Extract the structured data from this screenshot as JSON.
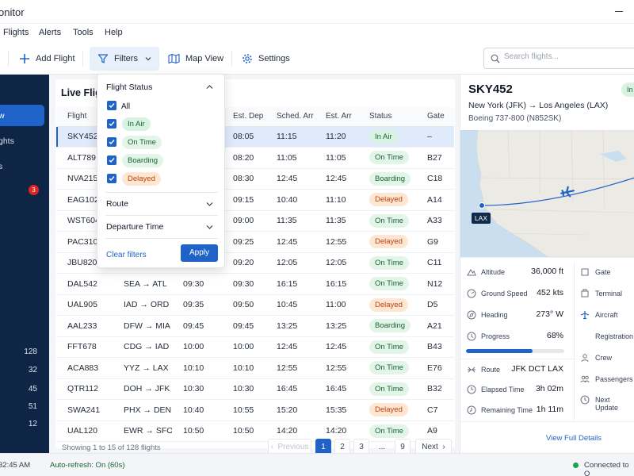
{
  "window": {
    "title": "onitor"
  },
  "menu": [
    "Flights",
    "Alerts",
    "Tools",
    "Help"
  ],
  "toolbar": {
    "add_flight": "Add Flight",
    "filters": "Filters",
    "map_view": "Map View",
    "settings": "Settings",
    "search_placeholder": "Search flights..."
  },
  "sidebar": {
    "items": [
      "w",
      "ghts",
      "s"
    ],
    "badge": "3",
    "counts": [
      "128",
      "32",
      "45",
      "51",
      "12"
    ]
  },
  "list": {
    "title": "Live Fligh",
    "columns": [
      "Flight",
      "Route",
      "Sched. Dep",
      "Est. Dep",
      "Sched. Arr",
      "Est. Arr",
      "Status",
      "Gate"
    ],
    "rows": [
      {
        "flight": "SKY452",
        "from": "",
        "to": "",
        "sched_dep": "",
        "est_dep": "08:05",
        "sched_arr": "11:15",
        "est_arr": "11:20",
        "status": "In Air",
        "gate": "–",
        "late": false
      },
      {
        "flight": "ALT789",
        "from": "",
        "to": "",
        "sched_dep": "",
        "est_dep": "08:20",
        "sched_arr": "11:05",
        "est_arr": "11:05",
        "status": "On Time",
        "gate": "B27",
        "late": false
      },
      {
        "flight": "NVA215",
        "from": "",
        "to": "",
        "sched_dep": "",
        "est_dep": "08:30",
        "sched_arr": "12:45",
        "est_arr": "12:45",
        "status": "Boarding",
        "gate": "C18",
        "late": false
      },
      {
        "flight": "EAG102",
        "from": "",
        "to": "",
        "sched_dep": "",
        "est_dep": "09:15",
        "sched_arr": "10:40",
        "est_arr": "11:10",
        "status": "Delayed",
        "gate": "A14",
        "late": true
      },
      {
        "flight": "WST604",
        "from": "",
        "to": "",
        "sched_dep": "",
        "est_dep": "09:00",
        "sched_arr": "11:35",
        "est_arr": "11:35",
        "status": "On Time",
        "gate": "A33",
        "late": false
      },
      {
        "flight": "PAC310",
        "from": "",
        "to": "",
        "sched_dep": "",
        "est_dep": "09:25",
        "sched_arr": "12:45",
        "est_arr": "12:55",
        "status": "Delayed",
        "gate": "G9",
        "late": true
      },
      {
        "flight": "JBU820",
        "from": "",
        "to": "",
        "sched_dep": "",
        "est_dep": "09:20",
        "sched_arr": "12:05",
        "est_arr": "12:05",
        "status": "On Time",
        "gate": "C11",
        "late": false
      },
      {
        "flight": "DAL542",
        "from": "SEA",
        "to": "ATL",
        "sched_dep": "09:30",
        "est_dep": "09:30",
        "sched_arr": "16:15",
        "est_arr": "16:15",
        "status": "On Time",
        "gate": "N12",
        "late": false
      },
      {
        "flight": "UAL905",
        "from": "IAD",
        "to": "ORD",
        "sched_dep": "09:35",
        "est_dep": "09:50",
        "sched_arr": "10:45",
        "est_arr": "11:00",
        "status": "Delayed",
        "gate": "D5",
        "late": true
      },
      {
        "flight": "AAL233",
        "from": "DFW",
        "to": "MIA",
        "sched_dep": "09:45",
        "est_dep": "09:45",
        "sched_arr": "13:25",
        "est_arr": "13:25",
        "status": "Boarding",
        "gate": "A21",
        "late": false
      },
      {
        "flight": "FFT678",
        "from": "CDG",
        "to": "IAD",
        "sched_dep": "10:00",
        "est_dep": "10:00",
        "sched_arr": "12:45",
        "est_arr": "12:45",
        "status": "On Time",
        "gate": "B43",
        "late": false
      },
      {
        "flight": "ACA883",
        "from": "YYZ",
        "to": "LAX",
        "sched_dep": "10:10",
        "est_dep": "10:10",
        "sched_arr": "12:55",
        "est_arr": "12:55",
        "status": "On Time",
        "gate": "E76",
        "late": false
      },
      {
        "flight": "QTR112",
        "from": "DOH",
        "to": "JFK",
        "sched_dep": "10:30",
        "est_dep": "10:30",
        "sched_arr": "16:45",
        "est_arr": "16:45",
        "status": "On Time",
        "gate": "B32",
        "late": false
      },
      {
        "flight": "SWA241",
        "from": "PHX",
        "to": "DEN",
        "sched_dep": "10:40",
        "est_dep": "10:55",
        "sched_arr": "15:20",
        "est_arr": "15:35",
        "status": "Delayed",
        "gate": "C7",
        "late": true
      },
      {
        "flight": "UAL120",
        "from": "EWR",
        "to": "SFO",
        "sched_dep": "10:50",
        "est_dep": "10:50",
        "sched_arr": "14:20",
        "est_arr": "14:20",
        "status": "On Time",
        "gate": "A9",
        "late": false
      }
    ],
    "showing": "Showing 1 to 15 of 128 flights",
    "pagination": {
      "previous": "Previous",
      "pages": [
        "1",
        "2",
        "3",
        "...",
        "9"
      ],
      "next": "Next"
    }
  },
  "filter_panel": {
    "heading": "Flight Status",
    "all": "All",
    "options": [
      {
        "label": "In Air",
        "color": "#166534",
        "bg": "#d9f2e1"
      },
      {
        "label": "On Time",
        "color": "#166534",
        "bg": "#e3f5e8"
      },
      {
        "label": "Boarding",
        "color": "#166534",
        "bg": "#e3f5e8"
      },
      {
        "label": "Delayed",
        "color": "#c2410c",
        "bg": "#fde7d3"
      }
    ],
    "route": "Route",
    "departure_time": "Departure Time",
    "clear": "Clear filters",
    "apply": "Apply"
  },
  "detail": {
    "flight": "SKY452",
    "status_short": "In",
    "route": "New York (JFK) → Los Angeles (LAX)",
    "aircraft": "Boeing 737-800 (N852SK)",
    "map_label": "LAX",
    "stats_left": [
      {
        "label": "Altitude",
        "value": "36,000 ft",
        "icon": "mountain-icon"
      },
      {
        "label": "Ground Speed",
        "value": "452 kts",
        "icon": "speed-icon"
      },
      {
        "label": "Heading",
        "value": "273° W",
        "icon": "compass-icon"
      },
      {
        "label": "Progress",
        "value": "68%",
        "icon": "clock-icon"
      },
      {
        "label": "Route",
        "value": "JFK DCT LAX",
        "icon": "route-icon"
      },
      {
        "label": "Elapsed Time",
        "value": "3h 02m",
        "icon": "timer-icon"
      },
      {
        "label": "Remaining Time",
        "value": "1h 11m",
        "icon": "hourglass-icon"
      }
    ],
    "progress_fraction": 0.68,
    "stats_right": [
      "Gate",
      "Terminal",
      "Aircraft",
      "Registration",
      "Crew",
      "Passengers",
      "Next Update"
    ],
    "view_full": "View Full Details"
  },
  "status_bar": {
    "time": "32:45 AM",
    "auto_refresh": "Auto-refresh: On (60s)",
    "connection": "Connected to O"
  },
  "colors": {
    "accent": "#1f63c9",
    "sidebar": "#0f2546",
    "late": "#ea7a1b"
  }
}
